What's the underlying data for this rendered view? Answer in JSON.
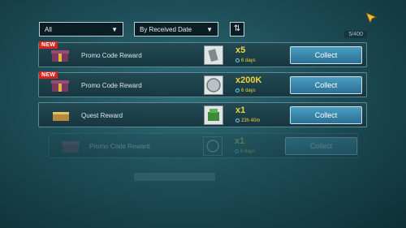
{
  "filters": {
    "type_value": "All",
    "sort_value": "By Received Date",
    "count": "5/400"
  },
  "rows": [
    {
      "badge": "NEW",
      "title": "Promo Code Reward",
      "qty": "x5",
      "timer": "6 days",
      "button": "Collect",
      "item_icon": "metal-plate-icon",
      "chest_icon": "gift-box-icon"
    },
    {
      "badge": "NEW",
      "title": "Promo Code Reward",
      "qty": "x200K",
      "timer": "6 days",
      "button": "Collect",
      "item_icon": "silver-coin-icon",
      "chest_icon": "gift-box-icon"
    },
    {
      "badge": "",
      "title": "Quest Reward",
      "qty": "x1",
      "timer": "23h 40m",
      "button": "Collect",
      "item_icon": "green-crate-icon",
      "chest_icon": "scroll-chest-icon"
    },
    {
      "badge": "",
      "title": "Promo Code Reward",
      "qty": "x1",
      "timer": "6 days",
      "button": "Collect",
      "item_icon": "speed-up-icon",
      "chest_icon": "gift-box-icon"
    }
  ],
  "colors": {
    "accent": "#f2d33a",
    "button": "#3b87ab",
    "badge": "#d8261e"
  }
}
